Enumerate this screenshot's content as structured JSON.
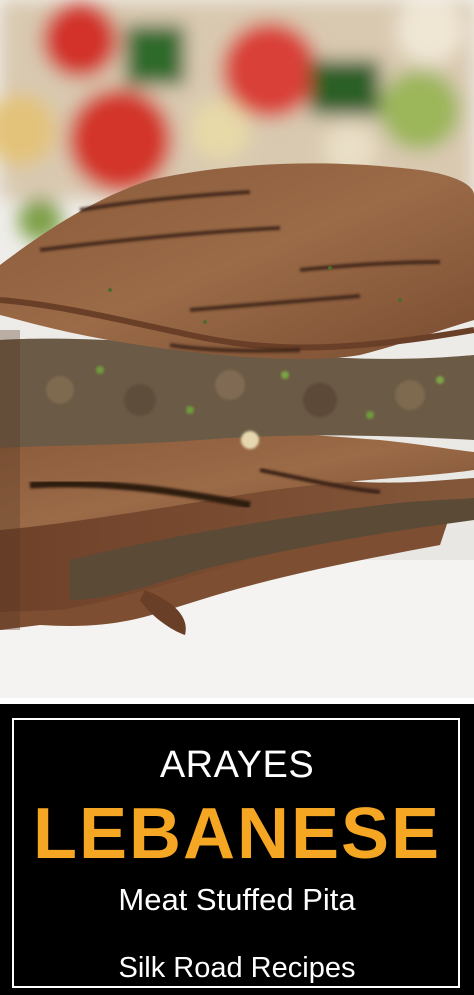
{
  "banner": {
    "title_top": "ARAYES",
    "title_main": "LEBANESE",
    "subtitle": "Meat Stuffed Pita",
    "brand": "Silk Road Recipes"
  },
  "colors": {
    "banner_bg": "#000000",
    "accent": "#f5a623",
    "text": "#ffffff"
  },
  "photo": {
    "subject": "grilled-stuffed-pita-photo"
  }
}
